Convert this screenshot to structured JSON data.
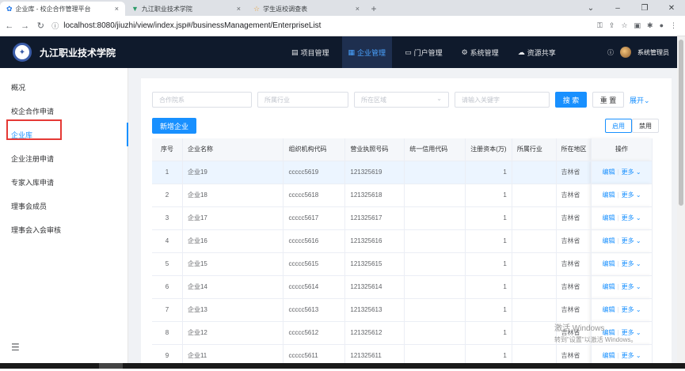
{
  "browser": {
    "tabs": [
      {
        "label": "企业库 - 校企合作管理平台",
        "active": true
      },
      {
        "label": "九江职业技术学院",
        "active": false
      },
      {
        "label": "学生返校调查表",
        "active": false
      }
    ],
    "url": "localhost:8080/jiuzhi/view/index.jsp#/businessManagement/EnterpriseList"
  },
  "header": {
    "school_name": "九江职业技术学院",
    "menu": [
      {
        "label": "项目管理",
        "icon": "building-icon",
        "active": false
      },
      {
        "label": "企业管理",
        "icon": "document-icon",
        "active": true
      },
      {
        "label": "门户管理",
        "icon": "monitor-icon",
        "active": false
      },
      {
        "label": "系统管理",
        "icon": "gear-icon",
        "active": false
      },
      {
        "label": "资源共享",
        "icon": "cloud-icon",
        "active": false
      }
    ],
    "user_name": "系统管理员"
  },
  "sidebar": {
    "items": [
      {
        "label": "概况",
        "active": false
      },
      {
        "label": "校企合作申请",
        "active": false
      },
      {
        "label": "企业库",
        "active": true
      },
      {
        "label": "企业注册申请",
        "active": false
      },
      {
        "label": "专家入库申请",
        "active": false
      },
      {
        "label": "理事会成员",
        "active": false
      },
      {
        "label": "理事会入会审核",
        "active": false
      }
    ]
  },
  "filters": {
    "partner_school_placeholder": "合作院系",
    "industry_placeholder": "所属行业",
    "region_placeholder": "所在区域",
    "keyword_placeholder": "请输入关键字",
    "search_label": "搜 索",
    "reset_label": "重 置",
    "expand_label": "展开"
  },
  "actions": {
    "add_label": "新增企业",
    "enable_label": "启用",
    "disable_label": "禁用"
  },
  "table": {
    "headers": [
      "序号",
      "企业名称",
      "组织机构代码",
      "营业执照号码",
      "统一信用代码",
      "注册资本(万)",
      "所属行业",
      "所在地区",
      "操作"
    ],
    "edit_label": "编辑",
    "more_label": "更多",
    "rows": [
      {
        "idx": "1",
        "name": "企业19",
        "org": "ccccc5619",
        "lic": "121325619",
        "credit": "",
        "capital": "1",
        "industry": "",
        "region": "吉林省"
      },
      {
        "idx": "2",
        "name": "企业18",
        "org": "ccccc5618",
        "lic": "121325618",
        "credit": "",
        "capital": "1",
        "industry": "",
        "region": "吉林省"
      },
      {
        "idx": "3",
        "name": "企业17",
        "org": "ccccc5617",
        "lic": "121325617",
        "credit": "",
        "capital": "1",
        "industry": "",
        "region": "吉林省"
      },
      {
        "idx": "4",
        "name": "企业16",
        "org": "ccccc5616",
        "lic": "121325616",
        "credit": "",
        "capital": "1",
        "industry": "",
        "region": "吉林省"
      },
      {
        "idx": "5",
        "name": "企业15",
        "org": "ccccc5615",
        "lic": "121325615",
        "credit": "",
        "capital": "1",
        "industry": "",
        "region": "吉林省"
      },
      {
        "idx": "6",
        "name": "企业14",
        "org": "ccccc5614",
        "lic": "121325614",
        "credit": "",
        "capital": "1",
        "industry": "",
        "region": "吉林省"
      },
      {
        "idx": "7",
        "name": "企业13",
        "org": "ccccc5613",
        "lic": "121325613",
        "credit": "",
        "capital": "1",
        "industry": "",
        "region": "吉林省"
      },
      {
        "idx": "8",
        "name": "企业12",
        "org": "ccccc5612",
        "lic": "121325612",
        "credit": "",
        "capital": "1",
        "industry": "",
        "region": "吉林省"
      },
      {
        "idx": "9",
        "name": "企业11",
        "org": "ccccc5611",
        "lic": "121325611",
        "credit": "",
        "capital": "1",
        "industry": "",
        "region": "吉林省"
      }
    ]
  },
  "watermark": {
    "line1": "激活 Windows",
    "line2": "转到\"设置\"以激活 Windows。"
  },
  "colors": {
    "accent": "#1890ff",
    "topbar": "#0f1a2c",
    "highlight_box": "#e53935"
  }
}
